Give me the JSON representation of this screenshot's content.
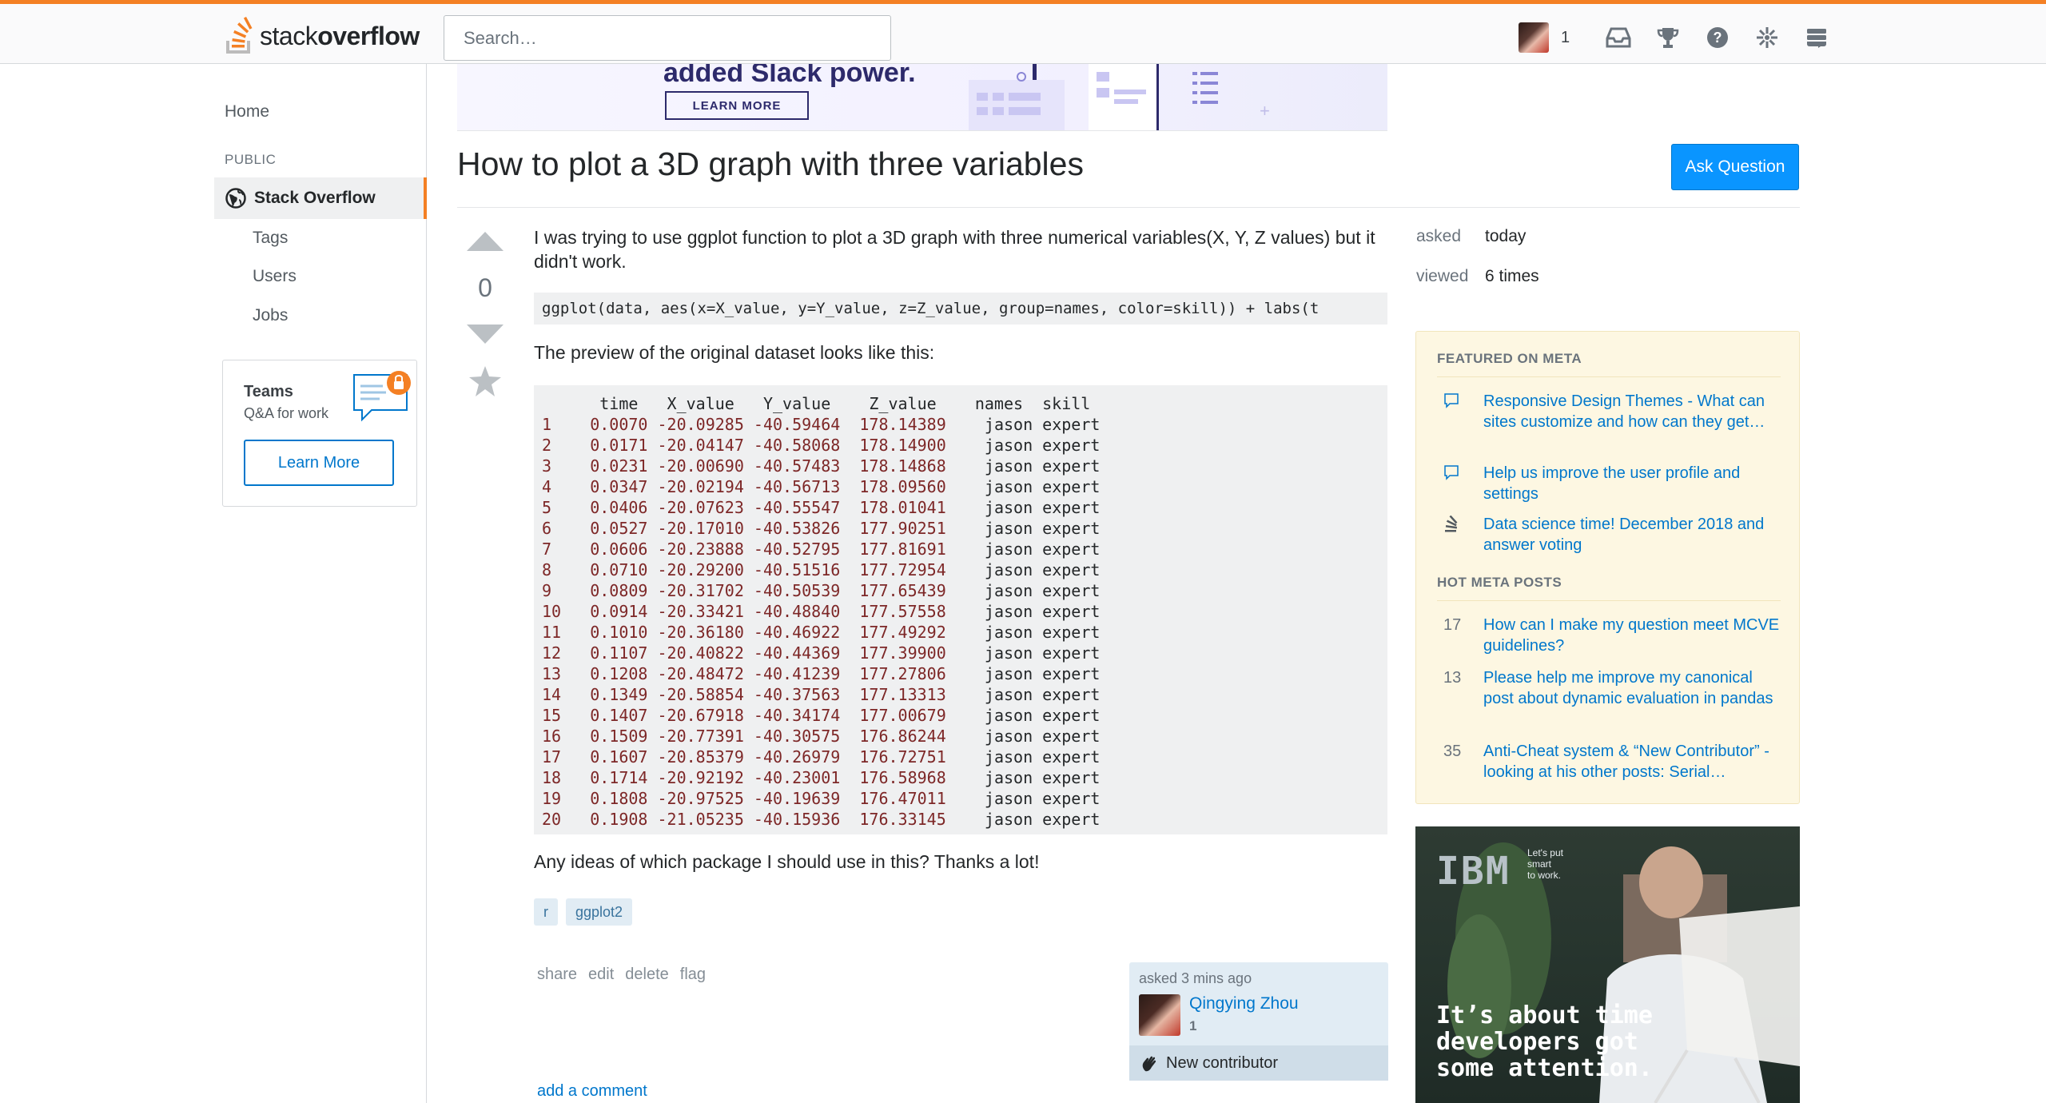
{
  "header": {
    "logo_light": "stack",
    "logo_bold": "overflow",
    "search_placeholder": "Search…",
    "reputation": "1"
  },
  "leftnav": {
    "home": "Home",
    "public_label": "PUBLIC",
    "stackoverflow": "Stack Overflow",
    "items": [
      "Tags",
      "Users",
      "Jobs"
    ],
    "teams": {
      "title": "Teams",
      "subtitle": "Q&A for work",
      "button": "Learn More"
    }
  },
  "ad_top": {
    "headline": "added Slack power.",
    "button": "LEARN MORE"
  },
  "question": {
    "title": "How to plot a 3D graph with three variables",
    "ask_button": "Ask Question",
    "votes": "0",
    "body_intro": "I was trying to use ggplot function to plot a 3D graph with three numerical variables(X, Y, Z values) but it didn't work.",
    "inline_code": "ggplot(data, aes(x=X_value, y=Y_value, z=Z_value, group=names, color=skill)) + labs(t",
    "preview_text": "The preview of the original dataset looks like this:",
    "table_header": "      time   X_value   Y_value    Z_value    names  skill",
    "table_rows": [
      "1    0.0070 -20.09285 -40.59464  178.14389    jason expert",
      "2    0.0171 -20.04147 -40.58068  178.14900    jason expert",
      "3    0.0231 -20.00690 -40.57483  178.14868    jason expert",
      "4    0.0347 -20.02194 -40.56713  178.09560    jason expert",
      "5    0.0406 -20.07623 -40.55547  178.01041    jason expert",
      "6    0.0527 -20.17010 -40.53826  177.90251    jason expert",
      "7    0.0606 -20.23888 -40.52795  177.81691    jason expert",
      "8    0.0710 -20.29200 -40.51516  177.72954    jason expert",
      "9    0.0809 -20.31702 -40.50539  177.65439    jason expert",
      "10   0.0914 -20.33421 -40.48840  177.57558    jason expert",
      "11   0.1010 -20.36180 -40.46922  177.49292    jason expert",
      "12   0.1107 -20.40822 -40.44369  177.39900    jason expert",
      "13   0.1208 -20.48472 -40.41239  177.27806    jason expert",
      "14   0.1349 -20.58854 -40.37563  177.13313    jason expert",
      "15   0.1407 -20.67918 -40.34174  177.00679    jason expert",
      "16   0.1509 -20.77391 -40.30575  176.86244    jason expert",
      "17   0.1607 -20.85379 -40.26979  176.72751    jason expert",
      "18   0.1714 -20.92192 -40.23001  176.58968    jason expert",
      "19   0.1808 -20.97525 -40.19639  176.47011    jason expert",
      "20   0.1908 -21.05235 -40.15936  176.33145    jason expert"
    ],
    "closing_text": "Any ideas of which package I should use in this? Thanks a lot!",
    "tags": [
      "r",
      "ggplot2"
    ],
    "menu": [
      "share",
      "edit",
      "delete",
      "flag"
    ],
    "add_comment": "add a comment",
    "owner": {
      "asked": "asked 3 mins ago",
      "name": "Qingying Zhou",
      "rep": "1",
      "badge": "New contributor"
    }
  },
  "stats": {
    "asked_label": "asked",
    "asked_value": "today",
    "viewed_label": "viewed",
    "viewed_value": "6 times"
  },
  "meta": {
    "featured_heading": "FEATURED ON META",
    "featured": [
      {
        "icon": "speech-bubble-icon",
        "text": "Responsive Design Themes - What can sites customize and how can they get…"
      },
      {
        "icon": "speech-bubble-icon",
        "text": "Help us improve the user profile and settings"
      },
      {
        "icon": "stack-exchange-icon",
        "text": "Data science time! December 2018 and answer voting"
      }
    ],
    "hot_heading": "HOT META POSTS",
    "hot": [
      {
        "count": "17",
        "text": "How can I make my question meet MCVE guidelines?"
      },
      {
        "count": "13",
        "text": "Please help me improve my canonical post about dynamic evaluation in pandas"
      },
      {
        "count": "35",
        "text": "Anti-Cheat system & “New Contributor” - looking at his other posts: Serial…"
      }
    ]
  },
  "ad_side": {
    "brand": "IBM",
    "small_line1": "Let's put",
    "small_line2": "smart",
    "small_line3": "to work.",
    "line1": "It’s about time",
    "line2": "developers got",
    "line3": "some attention."
  },
  "colors": {
    "accent_orange": "#f48024",
    "link_blue": "#0077cc",
    "button_blue": "#0a95ff",
    "meta_bg": "#fdf7e2",
    "code_num": "#7d2727"
  }
}
